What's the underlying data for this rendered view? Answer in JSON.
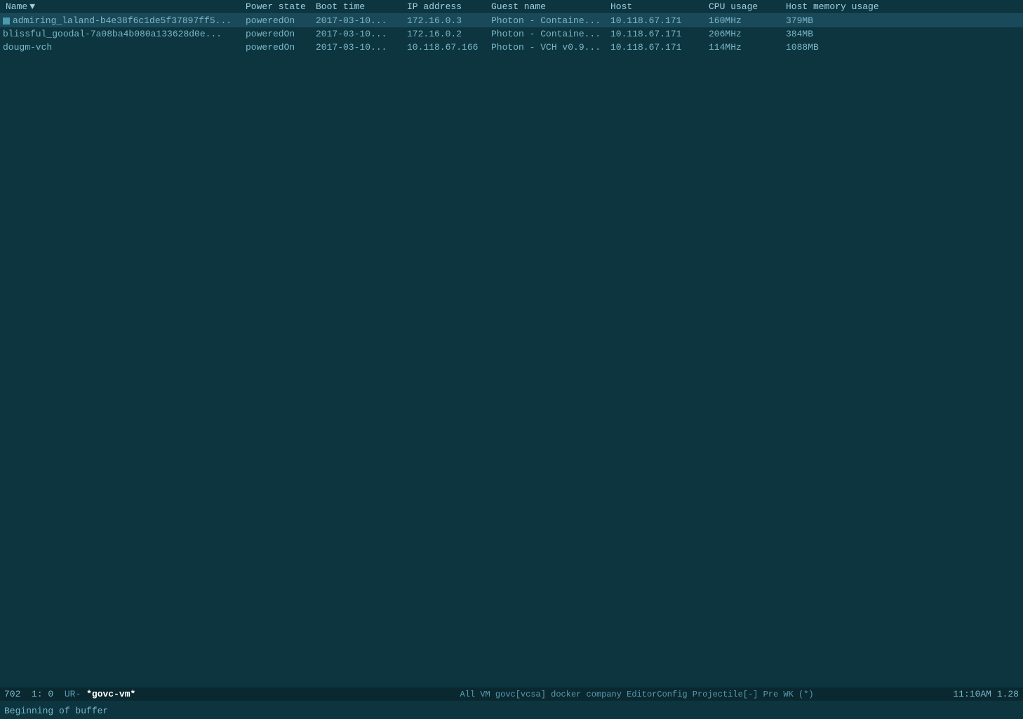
{
  "colors": {
    "bg": "#0d3540",
    "header_bg": "#0a2830",
    "text": "#8bbccc",
    "selected_bg": "#1a4a5a"
  },
  "table": {
    "headers": [
      {
        "id": "name",
        "label": "Name",
        "sortable": true,
        "sort_indicator": "▼"
      },
      {
        "id": "power",
        "label": "Power state"
      },
      {
        "id": "boot",
        "label": "Boot time"
      },
      {
        "id": "ip",
        "label": "IP address"
      },
      {
        "id": "guest",
        "label": "Guest name"
      },
      {
        "id": "host",
        "label": "Host"
      },
      {
        "id": "cpu",
        "label": "CPU usage"
      },
      {
        "id": "mem",
        "label": "Host memory usage"
      }
    ],
    "rows": [
      {
        "name": "admiring_laland-b4e38f6c1de5f37897ff5...",
        "power": "poweredOn",
        "boot": "2017-03-10...",
        "ip": "172.16.0.3",
        "guest": "Photon - Containe...",
        "host": "10.118.67.171",
        "cpu": "160MHz",
        "mem": "379MB",
        "selected": true
      },
      {
        "name": "blissful_goodal-7a08ba4b080a133628d0e...",
        "power": "poweredOn",
        "boot": "2017-03-10...",
        "ip": "172.16.0.2",
        "guest": "Photon - Containe...",
        "host": "10.118.67.171",
        "cpu": "206MHz",
        "mem": "384MB",
        "selected": false
      },
      {
        "name": "dougm-vch",
        "power": "poweredOn",
        "boot": "2017-03-10...",
        "ip": "10.118.67.166",
        "guest": "Photon - VCH v0.9...",
        "host": "10.118.67.171",
        "cpu": "114MHz",
        "mem": "1088MB",
        "selected": false
      }
    ]
  },
  "status_bar": {
    "position": "702",
    "line_col": "1: 0",
    "mode": "UR-",
    "filename": "*govc-vm*",
    "center_text": "All VM govc[vcsa] docker company EditorConfig Projectile[-] Pre WK (*)",
    "time": "11:10AM",
    "version": "1.28"
  },
  "bottom_bar": {
    "text": "Beginning of buffer"
  }
}
